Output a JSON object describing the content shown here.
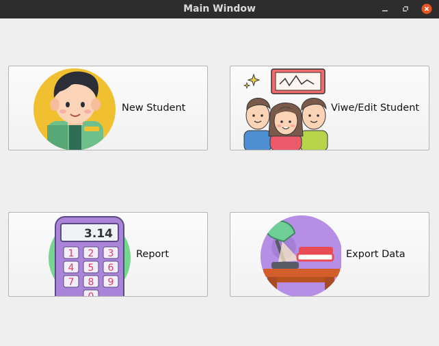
{
  "window": {
    "title": "Main Window",
    "controls": [
      "minimize-icon",
      "maximize-icon",
      "close-icon"
    ]
  },
  "buttons": [
    {
      "id": "new-student",
      "label": "New Student",
      "icon": "student-avatar-icon"
    },
    {
      "id": "view-edit-student",
      "label": "Viwe/Edit Student",
      "icon": "students-group-icon"
    },
    {
      "id": "report",
      "label": "Report",
      "icon": "calculator-icon"
    },
    {
      "id": "export-data",
      "label": "Export Data",
      "icon": "desk-lamp-icon"
    }
  ],
  "calculator": {
    "display": "3.14",
    "keys": [
      "1",
      "2",
      "3",
      "4",
      "5",
      "6",
      "7",
      "8",
      "9",
      "0"
    ]
  },
  "colors": {
    "titlebar": "#2d2d2d",
    "close_button": "#e95420",
    "background": "#efefef"
  }
}
